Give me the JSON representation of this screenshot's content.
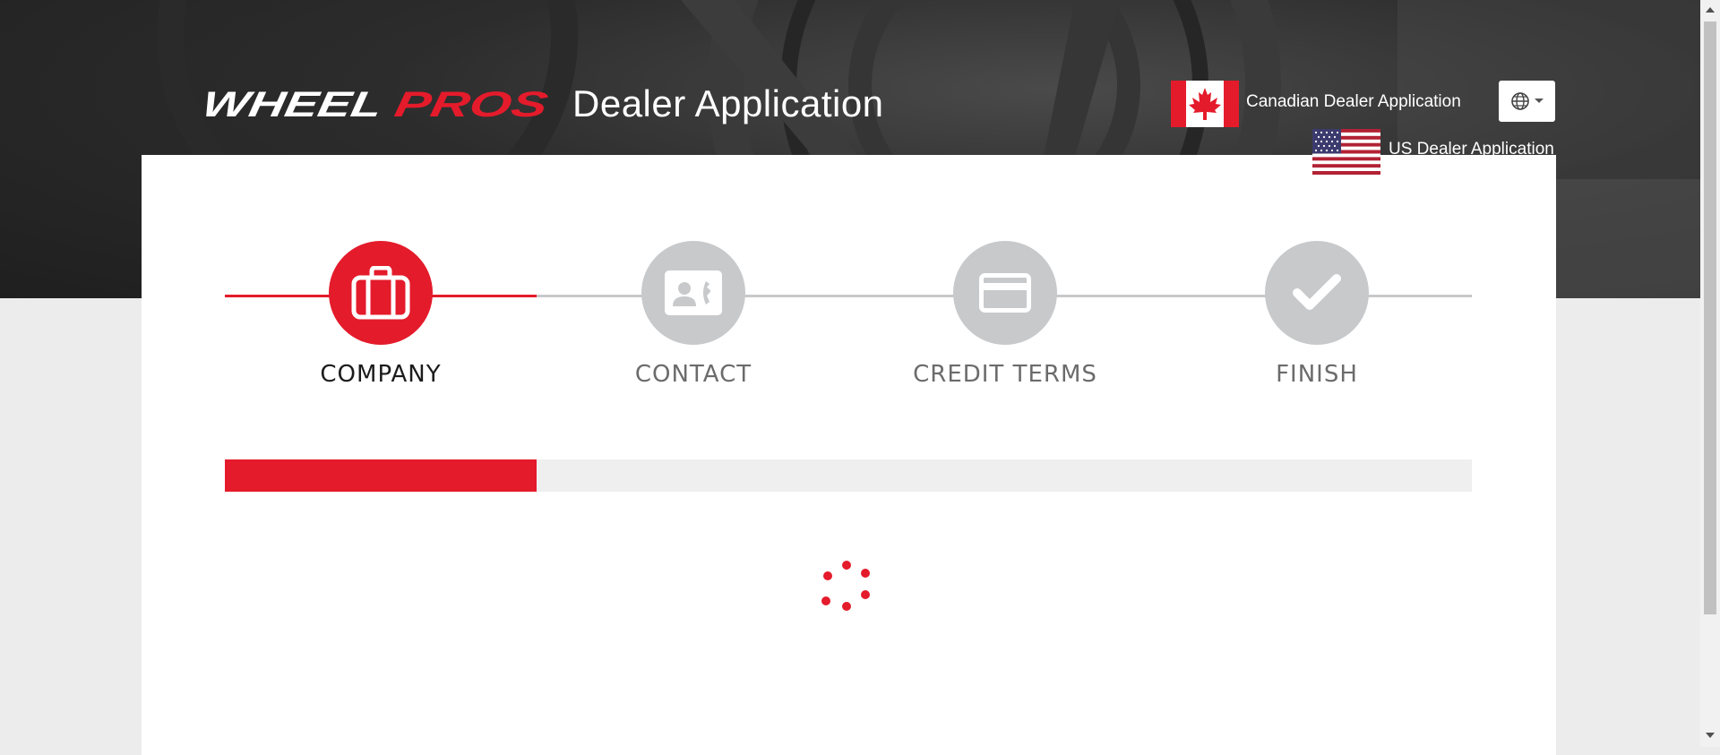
{
  "header": {
    "brand_first": "WHEEL",
    "brand_second": "PROS",
    "title": "Dealer Application",
    "canadian_link": "Canadian Dealer Application",
    "us_link": "US Dealer Application"
  },
  "icons": {
    "canada_flag": "canada-flag-icon",
    "us_flag": "us-flag-icon",
    "language": "globe-icon",
    "language_caret": "caret-down-icon",
    "step1": "briefcase-icon",
    "step2": "contact-card-icon",
    "step3": "credit-card-icon",
    "step4": "checkmark-icon",
    "loading": "loading-spinner-icon"
  },
  "colors": {
    "accent": "#e41b2b",
    "inactive": "#c8c9cb",
    "inactive_text": "#6b6b6b",
    "active_text": "#1b1b1b"
  },
  "steps": [
    {
      "label": "COMPANY",
      "active": true
    },
    {
      "label": "CONTACT",
      "active": false
    },
    {
      "label": "CREDIT TERMS",
      "active": false
    },
    {
      "label": "FINISH",
      "active": false
    }
  ],
  "progress": {
    "completed_steps": 1,
    "total_steps": 4,
    "fraction": 0.25
  }
}
